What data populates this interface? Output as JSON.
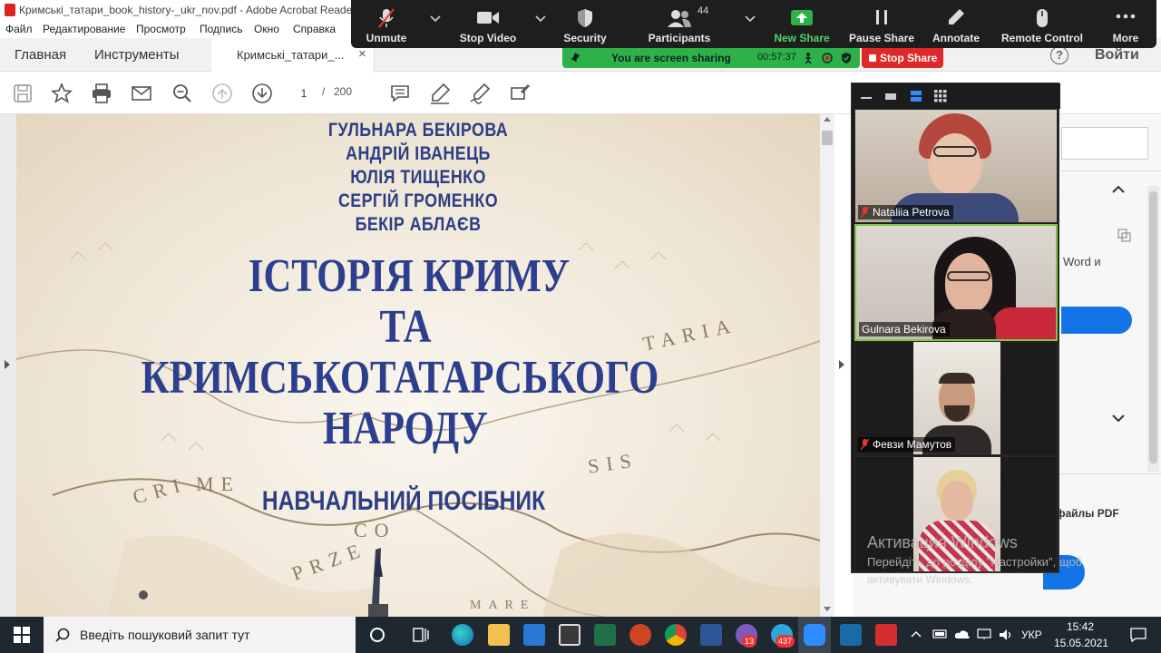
{
  "window": {
    "title": "Кримські_татари_book_history-_ukr_nov.pdf - Adobe Acrobat Reader"
  },
  "menu": [
    "Файл",
    "Редактирование",
    "Просмотр",
    "Подпись",
    "Окно",
    "Справка"
  ],
  "tabs": {
    "home": "Главная",
    "tools": "Инструменты",
    "document": "Кримські_татари_...",
    "close": "×"
  },
  "toolbar": {
    "page_current": "1",
    "page_separator": "/",
    "page_total": "200"
  },
  "signin": {
    "help": "?",
    "label": "Войти"
  },
  "zoom": {
    "buttons": [
      {
        "label": "Unmute",
        "icon": "mic-muted-icon"
      },
      {
        "label": "Stop Video",
        "icon": "video-camera-icon"
      },
      {
        "label": "Security",
        "icon": "shield-icon"
      },
      {
        "label": "Participants",
        "icon": "participants-icon",
        "count": "44"
      },
      {
        "label": "New Share",
        "icon": "share-arrow-icon"
      },
      {
        "label": "Pause Share",
        "icon": "pause-icon"
      },
      {
        "label": "Annotate",
        "icon": "pencil-icon"
      },
      {
        "label": "Remote Control",
        "icon": "mouse-icon"
      },
      {
        "label": "More",
        "icon": "ellipsis-icon"
      }
    ],
    "sharing_text": "You are screen sharing",
    "timer": "00:57:37",
    "stop_share": "Stop Share",
    "colors": {
      "share_green": "#2db24a",
      "stop_red": "#e02828",
      "active_border": "#7ec54d"
    }
  },
  "participants": [
    {
      "name": "Nataliia Petrova",
      "muted": true
    },
    {
      "name": "Gulnara Bekirova",
      "muted": false,
      "active": true
    },
    {
      "name": "Февзи Мамутов",
      "muted": true
    },
    {
      "name": "",
      "muted": false
    }
  ],
  "book": {
    "authors": [
      "ГУЛЬНАРА БЕКІРОВА",
      "АНДРІЙ ІВАНЕЦЬ",
      "ЮЛІЯ ТИЩЕНКО",
      "СЕРГІЙ ГРОМЕНКО",
      "БЕКІР АБЛАЄВ"
    ],
    "title_lines": [
      "ІСТОРІЯ КРИМУ",
      "ТА",
      "КРИМСЬКОТАТАРСЬКОГО",
      "НАРОДУ"
    ],
    "subtitle": "НАВЧАЛЬНИЙ ПОСІБНИК",
    "map_words": [
      "TARIA",
      "CRI",
      "ME",
      "SIS",
      "PRZE",
      "CO",
      "MARE"
    ]
  },
  "right_panel": {
    "word_text": "Word и",
    "f_text": "й",
    "pdf_text": "е файлы PDF"
  },
  "windows_activation": {
    "line1": "Активация Windows",
    "line2": "Перейдіть до розділу \"Настройки\", щоб",
    "line3": "активувати Windows."
  },
  "taskbar": {
    "search_placeholder": "Введіть пошуковий запит тут",
    "viber_badge": "13",
    "telegram_badge": "437",
    "language": "УКР",
    "time": "15:42",
    "date": "15.05.2021"
  }
}
